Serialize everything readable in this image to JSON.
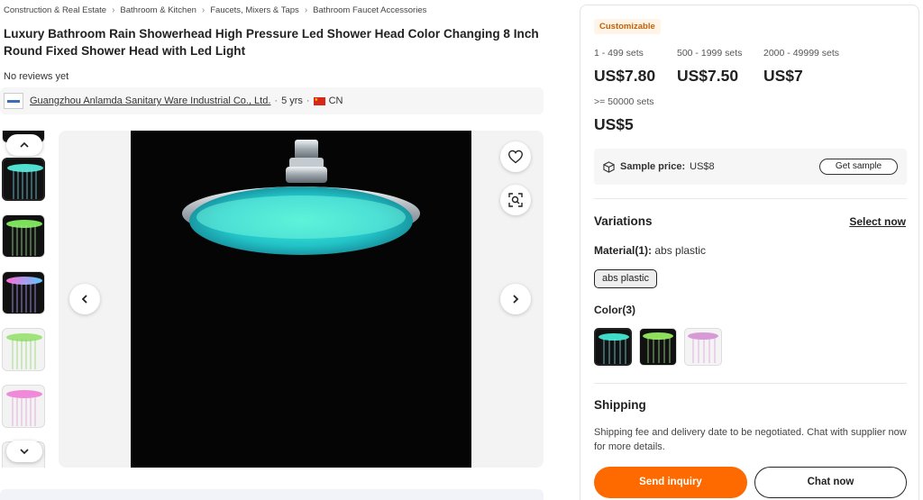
{
  "breadcrumb": [
    "Construction & Real Estate",
    "Bathroom & Kitchen",
    "Faucets, Mixers & Taps",
    "Bathroom Faucet Accessories"
  ],
  "product": {
    "title_line1": "Luxury Bathroom Rain Showerhead High Pressure Led Shower Head Color Changing 8 Inch",
    "title_line2": "Round Fixed Shower Head with Led Light",
    "reviews": "No reviews yet"
  },
  "supplier": {
    "name": "Guangzhou Anlamda Sanitary Ware Industrial Co., Ltd.",
    "years": "5 yrs",
    "country": "CN"
  },
  "gallery": {
    "icons": [
      "chevron-up-icon",
      "chevron-down-icon",
      "chevron-left-icon",
      "chevron-right-icon",
      "heart-icon",
      "image-search-icon"
    ]
  },
  "pricing": {
    "badge": "Customizable",
    "tiers": [
      {
        "range": "1 - 499 sets",
        "price": "US$7.80"
      },
      {
        "range": "500 - 1999 sets",
        "price": "US$7.50"
      },
      {
        "range": "2000 - 49999 sets",
        "price": "US$7"
      },
      {
        "range": ">= 50000 sets",
        "price": "US$5"
      }
    ],
    "sample_label": "Sample price:",
    "sample_value": "US$8",
    "get_sample": "Get sample"
  },
  "variations": {
    "title": "Variations",
    "select_now": "Select now",
    "material_label": "Material(1):",
    "material_value": "abs plastic",
    "material_option": "abs plastic",
    "color_label": "Color(3)",
    "colors": [
      "#2fd3b8",
      "#8ee05a",
      "#d79ad6"
    ]
  },
  "shipping": {
    "title": "Shipping",
    "text": "Shipping fee and delivery date to be negotiated. Chat with supplier now for more details."
  },
  "actions": {
    "send_inquiry": "Send inquiry",
    "chat_now": "Chat now"
  },
  "colors": {
    "accent": "#ff6a00",
    "badge_bg": "#fff4e6",
    "badge_text": "#c3600a"
  }
}
